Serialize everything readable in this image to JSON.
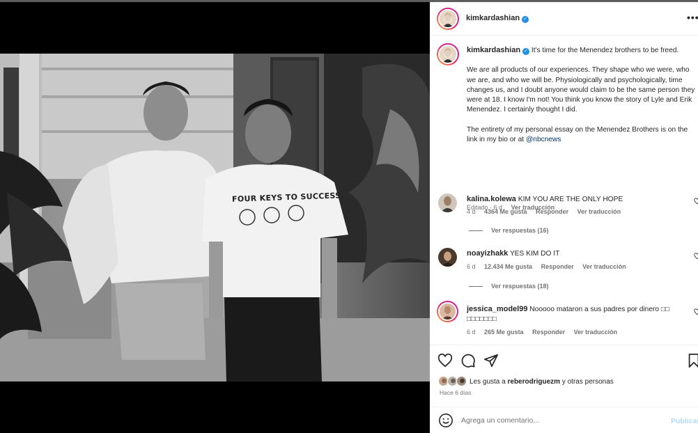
{
  "colors": {
    "accent": "#0095f6",
    "verified": "#1f8fe5",
    "link": "#00376b",
    "muted": "#737373"
  },
  "post": {
    "username": "kimkardashian",
    "verified": true,
    "photo": {
      "shirt_text": "FOUR KEYS TO SUCCESS."
    },
    "caption": {
      "username": "kimkardashian",
      "lines": [
        "It's time for the Menendez brothers to be freed.",
        "We are all products of our experiences. They shape who we were, who we are, and who we will be. Physiologically and psychologically, time changes us, and I doubt anyone would claim to be the same person they were at 18. I know I'm not! You think you know the story of Lyle and Erik Menendez. I certainly thought I did.",
        "The entirety of my personal essay on the Menendez Brothers is on the link in my bio or at "
      ],
      "mention": "@nbcnews",
      "edited": "Editado · 6 d",
      "translate": "Ver traducción"
    },
    "comments": [
      {
        "username": "kalina.kolewa",
        "text": "KIM YOU ARE THE ONLY HOPE",
        "age": "4 d",
        "likes": "4364 Me gusta",
        "reply": "Responder",
        "translate": "Ver traducción",
        "replies": "Ver respuestas (16)"
      },
      {
        "username": "noayizhakk",
        "text": "YES KIM DO IT",
        "age": "6 d",
        "likes": "12.434 Me gusta",
        "reply": "Responder",
        "translate": "Ver traducción",
        "replies": "Ver respuestas (18)"
      },
      {
        "username": "jessica_model99",
        "text": "Nooooo mataron a sus padres por dinero □□ □□□□□□□",
        "age": "6 d",
        "likes": "265 Me gusta",
        "reply": "Responder",
        "translate": "Ver traducción"
      }
    ],
    "likes": {
      "prefix": "Les gusta a ",
      "user": "reberodriguezm",
      "suffix": " y otras personas"
    },
    "time": "Hace 6 días",
    "add_comment": {
      "placeholder": "Agrega un comentario...",
      "publish": "Publicar"
    },
    "more_label": "•••"
  }
}
